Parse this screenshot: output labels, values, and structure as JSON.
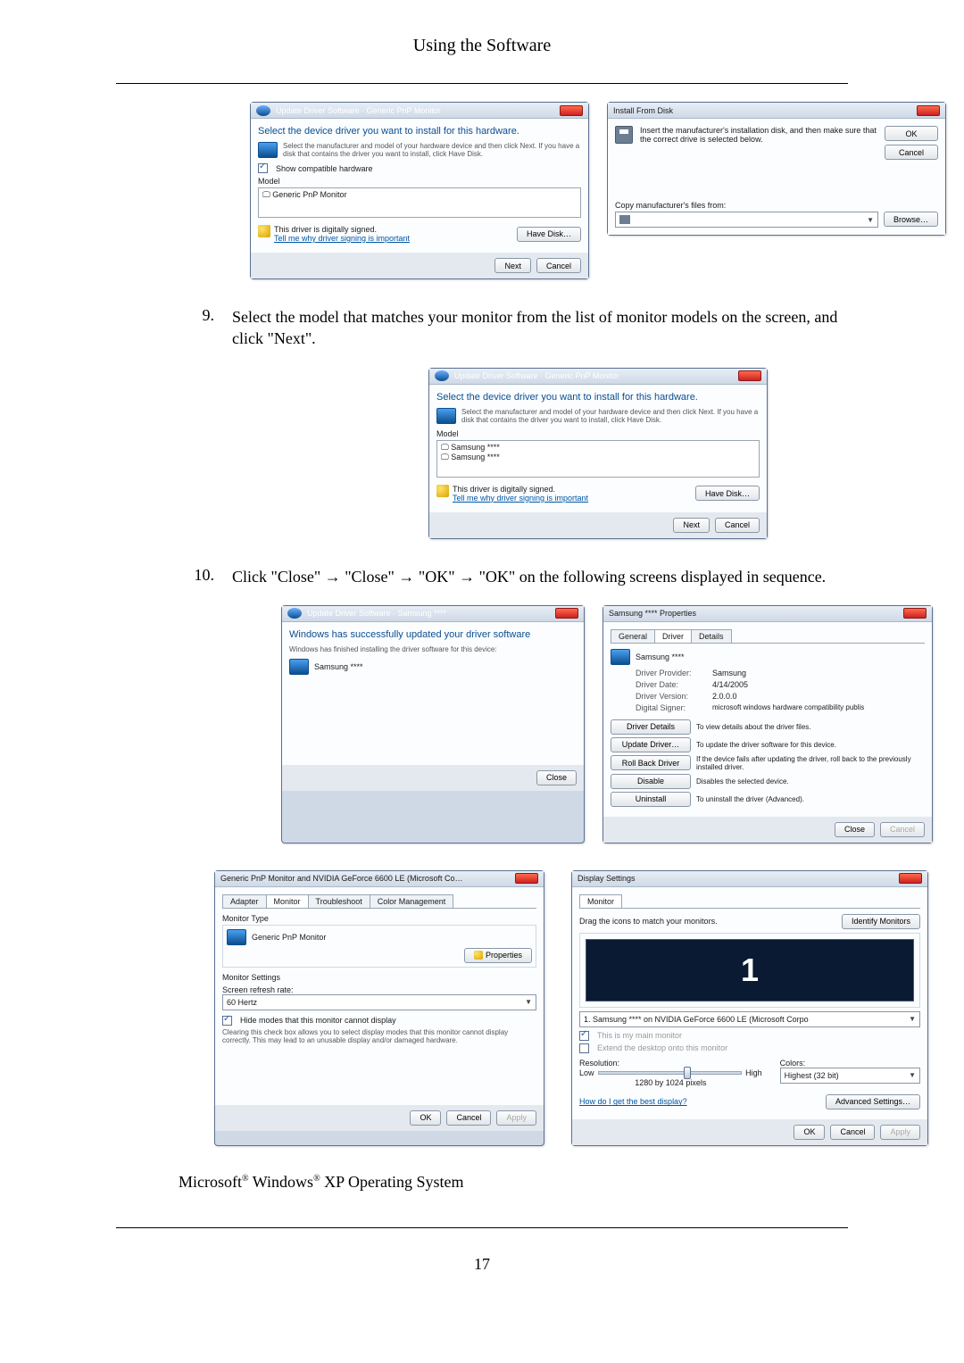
{
  "header": {
    "title": "Using the Software"
  },
  "fig1_update": {
    "title": "Update Driver Software · Generic PnP Monitor",
    "headline": "Select the device driver you want to install for this hardware.",
    "hint": "Select the manufacturer and model of your hardware device and then click Next. If you have a disk that contains the driver you want to install, click Have Disk.",
    "show_compatible": "Show compatible hardware",
    "col_model": "Model",
    "item1": "Generic PnP Monitor",
    "signed": "This driver is digitally signed.",
    "why_link": "Tell me why driver signing is important",
    "have_disk": "Have Disk…",
    "next": "Next",
    "cancel": "Cancel"
  },
  "fig1_disk": {
    "title": "Install From Disk",
    "text": "Insert the manufacturer's installation disk, and then make sure that the correct drive is selected below.",
    "copy_label": "Copy manufacturer's files from:",
    "ok": "OK",
    "cancel": "Cancel",
    "browse": "Browse…"
  },
  "step9": {
    "num": "9.",
    "text": "Select the model that matches your monitor from the list of monitor models on the screen, and click \"Next\"."
  },
  "fig2_update": {
    "title": "Update Driver Software · Generic PnP Monitor",
    "headline": "Select the device driver you want to install for this hardware.",
    "hint": "Select the manufacturer and model of your hardware device and then click Next. If you have a disk that contains the driver you want to install, click Have Disk.",
    "col_model": "Model",
    "item1": "Samsung ****",
    "item2": "Samsung ****",
    "signed": "This driver is digitally signed.",
    "why_link": "Tell me why driver signing is important",
    "have_disk": "Have Disk…",
    "next": "Next",
    "cancel": "Cancel"
  },
  "step10": {
    "num": "10.",
    "text": "Click \"Close\" → \"Close\" → \"OK\" → \"OK\" on the following screens displayed in sequence."
  },
  "fig3_done": {
    "title": "Update Driver Software · Samsung ****",
    "headline": "Windows has successfully updated your driver software",
    "sub": "Windows has finished installing the driver software for this device:",
    "device": "Samsung ****",
    "close": "Close"
  },
  "fig3_props": {
    "title": "Samsung **** Properties",
    "tab_general": "General",
    "tab_driver": "Driver",
    "tab_details": "Details",
    "device": "Samsung ****",
    "k_provider": "Driver Provider:",
    "v_provider": "Samsung",
    "k_date": "Driver Date:",
    "v_date": "4/14/2005",
    "k_version": "Driver Version:",
    "v_version": "2.0.0.0",
    "k_signer": "Digital Signer:",
    "v_signer": "microsoft windows hardware compatibility publis",
    "b_details": "Driver Details",
    "d_details": "To view details about the driver files.",
    "b_update": "Update Driver…",
    "d_update": "To update the driver software for this device.",
    "b_rollback": "Roll Back Driver",
    "d_rollback": "If the device fails after updating the driver, roll back to the previously installed driver.",
    "b_disable": "Disable",
    "d_disable": "Disables the selected device.",
    "b_uninstall": "Uninstall",
    "d_uninstall": "To uninstall the driver (Advanced).",
    "close": "Close",
    "cancel": "Cancel"
  },
  "fig4_monprops": {
    "title": "Generic PnP Monitor and NVIDIA GeForce 6600 LE (Microsoft Co…",
    "tab_adapter": "Adapter",
    "tab_monitor": "Monitor",
    "tab_trouble": "Troubleshoot",
    "tab_color": "Color Management",
    "grp_montype": "Monitor Type",
    "device": "Generic PnP Monitor",
    "btn_properties": "Properties",
    "grp_monsettings": "Monitor Settings",
    "lbl_refresh": "Screen refresh rate:",
    "val_refresh": "60 Hertz",
    "chk_hide": "Hide modes that this monitor cannot display",
    "warn": "Clearing this check box allows you to select display modes that this monitor cannot display correctly. This may lead to an unusable display and/or damaged hardware.",
    "ok": "OK",
    "cancel": "Cancel",
    "apply": "Apply"
  },
  "fig4_display": {
    "title": "Display Settings",
    "tab_monitor": "Monitor",
    "drag_text": "Drag the icons to match your monitors.",
    "identify": "Identify Monitors",
    "preview_num": "1",
    "sel_device": "1. Samsung **** on NVIDIA GeForce 6600 LE (Microsoft Corpo",
    "chk_main": "This is my main monitor",
    "chk_extend": "Extend the desktop onto this monitor",
    "lbl_resolution": "Resolution:",
    "res_low": "Low",
    "res_high": "High",
    "res_value": "1280 by 1024 pixels",
    "lbl_colors": "Colors:",
    "val_colors": "Highest (32 bit)",
    "link_best": "How do I get the best display?",
    "adv": "Advanced Settings…",
    "ok": "OK",
    "cancel": "Cancel",
    "apply": "Apply"
  },
  "os_line": {
    "text_prefix": "Microsoft",
    "sup": "®",
    "text_mid": " Windows",
    "text_suffix": " XP Operating System"
  },
  "page_number": "17"
}
